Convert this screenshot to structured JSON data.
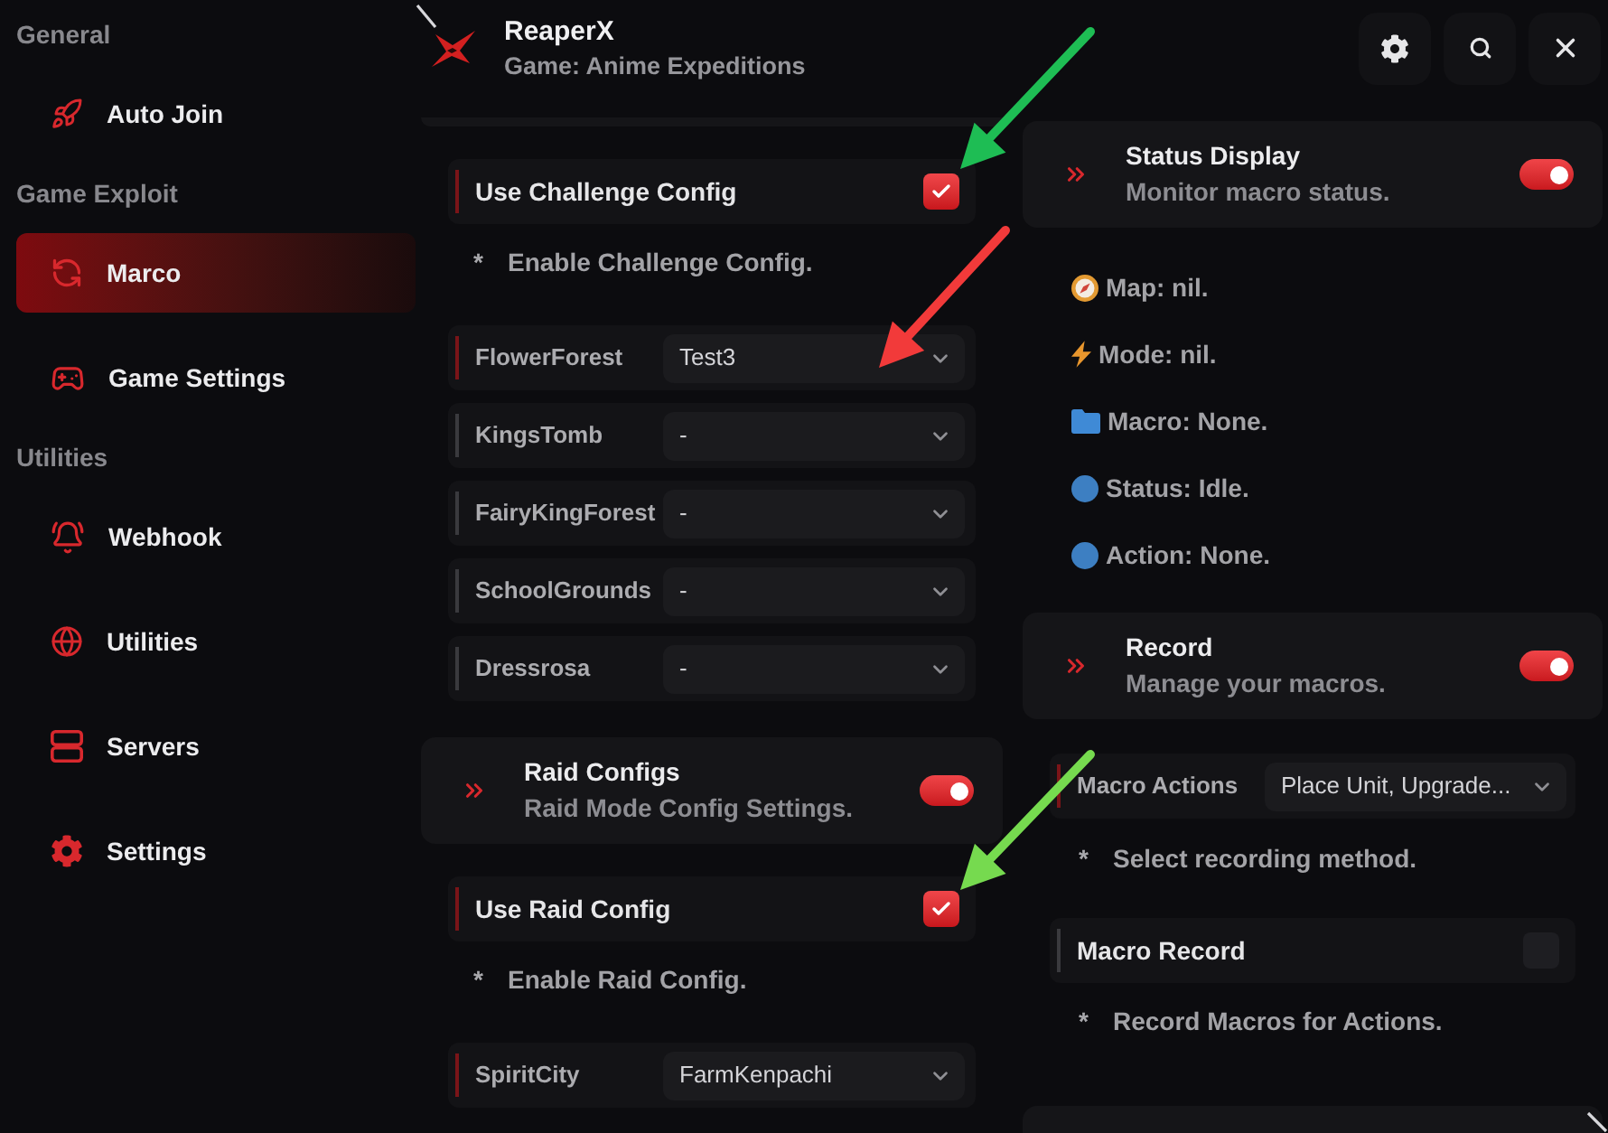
{
  "header": {
    "title": "ReaperX",
    "subtitle": "Game: Anime Expeditions"
  },
  "sidebar": {
    "sections": [
      {
        "label": "General",
        "items": [
          {
            "label": "Auto Join",
            "selected": false
          }
        ]
      },
      {
        "label": "Game Exploit",
        "items": [
          {
            "label": "Marco",
            "selected": true
          },
          {
            "label": "Game Settings",
            "selected": false
          }
        ]
      },
      {
        "label": "Utilities",
        "items": [
          {
            "label": "Webhook",
            "selected": false
          },
          {
            "label": "Utilities",
            "selected": false
          },
          {
            "label": "Servers",
            "selected": false
          },
          {
            "label": "Settings",
            "selected": false
          }
        ]
      }
    ]
  },
  "left_column": [
    {
      "kind": "section_edge"
    },
    {
      "kind": "checkbox",
      "label": "Use Challenge Config",
      "checked": true,
      "focused": true
    },
    {
      "kind": "note",
      "bullet": "*",
      "text": "Enable Challenge Config."
    },
    {
      "kind": "select",
      "label": "FlowerForest",
      "value": "Test3",
      "focused": true
    },
    {
      "kind": "select",
      "label": "KingsTomb",
      "value": "-",
      "focused": false
    },
    {
      "kind": "select",
      "label": "FairyKingForest",
      "value": "-",
      "focused": false
    },
    {
      "kind": "select",
      "label": "SchoolGrounds",
      "value": "-",
      "focused": false
    },
    {
      "kind": "select",
      "label": "Dressrosa",
      "value": "-",
      "focused": false
    },
    {
      "kind": "section",
      "title": "Raid Configs",
      "subtitle": "Raid Mode Config Settings.",
      "on": true
    },
    {
      "kind": "checkbox",
      "label": "Use Raid Config",
      "checked": true,
      "focused": true
    },
    {
      "kind": "note",
      "bullet": "*",
      "text": "Enable Raid Config."
    },
    {
      "kind": "select",
      "label": "SpiritCity",
      "value": "FarmKenpachi",
      "focused": true
    }
  ],
  "right_column": [
    {
      "kind": "section",
      "title": "Status Display",
      "subtitle": "Monitor macro status.",
      "on": true
    },
    {
      "kind": "status",
      "text": "Map: nil."
    },
    {
      "kind": "status",
      "text": "Mode: nil."
    },
    {
      "kind": "status",
      "text": "Macro: None."
    },
    {
      "kind": "status",
      "text": "Status: Idle."
    },
    {
      "kind": "status",
      "text": "Action: None."
    },
    {
      "kind": "section",
      "title": "Record",
      "subtitle": "Manage your macros.",
      "on": true
    },
    {
      "kind": "select",
      "label": "Macro Actions",
      "value": "Place Unit, Upgrade...",
      "focused": true
    },
    {
      "kind": "note",
      "bullet": "*",
      "text": "Select recording method."
    },
    {
      "kind": "checkbox",
      "label": "Macro Record",
      "checked": false,
      "focused": false
    },
    {
      "kind": "note",
      "bullet": "*",
      "text": "Record Macros for Actions."
    },
    {
      "kind": "section_edge"
    }
  ],
  "annotation_arrows": [
    {
      "color": "#1ebd54"
    },
    {
      "color": "#f23a3a"
    },
    {
      "color": "#76da4f"
    }
  ]
}
